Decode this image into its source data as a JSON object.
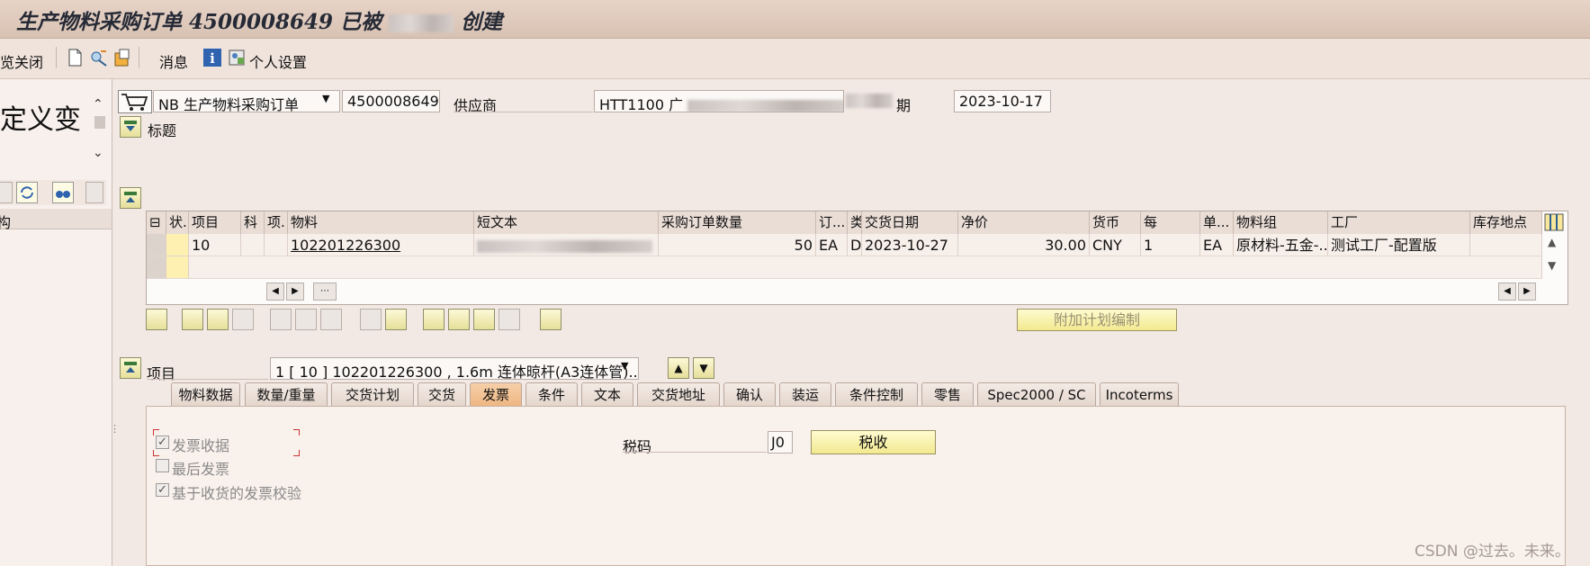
{
  "window": {
    "title_prefix": "生产物料采购订单 ",
    "po_number": "4500008649",
    "title_mid": " 已被 ",
    "title_suffix": " 创建"
  },
  "toolbar": {
    "doc_overview_close": "览关闭",
    "messages": "消息",
    "personal_settings": "个人设置"
  },
  "left_panel": {
    "text": "定义变",
    "col_label": "构"
  },
  "header": {
    "doc_type": "NB 生产物料采购订单",
    "po_number": "4500008649",
    "vendor_label": "供应商",
    "vendor_value": "HTT1100 广",
    "date_label": "期",
    "date_value": "2023-10-17",
    "header_label": "标题"
  },
  "table": {
    "columns": [
      "状.",
      "项目",
      "科",
      "项.",
      "物料",
      "短文本",
      "采购订单数量",
      "订...",
      "类",
      "交货日期",
      "净价",
      "货币",
      "每",
      "单...",
      "物料组",
      "工厂",
      "库存地点"
    ],
    "rows": [
      {
        "item": "10",
        "material": "102201226300",
        "short_text": "1...5..",
        "qty": "50",
        "unit": "EA",
        "d": "D",
        "delivery_date": "2023-10-27",
        "net_price": "30.00",
        "currency": "CNY",
        "per": "1",
        "order_unit": "EA",
        "material_group": "原材料-五金-...",
        "plant": "测试工厂-配置版"
      }
    ]
  },
  "buttons": {
    "add_planning": "附加计划编制",
    "tax": "税收"
  },
  "item_section": {
    "label": "项目",
    "selected": "1 [ 10 ] 102201226300 , 1.6m 连体晾杆(A3连体管)..."
  },
  "tabs": [
    "物料数据",
    "数量/重量",
    "交货计划",
    "交货",
    "发票",
    "条件",
    "文本",
    "交货地址",
    "确认",
    "装运",
    "条件控制",
    "零售",
    "Spec2000 / SC",
    "Incoterms"
  ],
  "active_tab": "发票",
  "invoice": {
    "inv_receipt": "发票收据",
    "final_invoice": "最后发票",
    "gr_based_iv": "基于收货的发票校验",
    "tax_code_label": "税码",
    "tax_code_value": "J0"
  },
  "watermark": "CSDN @过去。未来。",
  "colors": {
    "active_tab": "#eeb782",
    "yellow_button": "#f2e98f",
    "link_underline": "#111111"
  }
}
